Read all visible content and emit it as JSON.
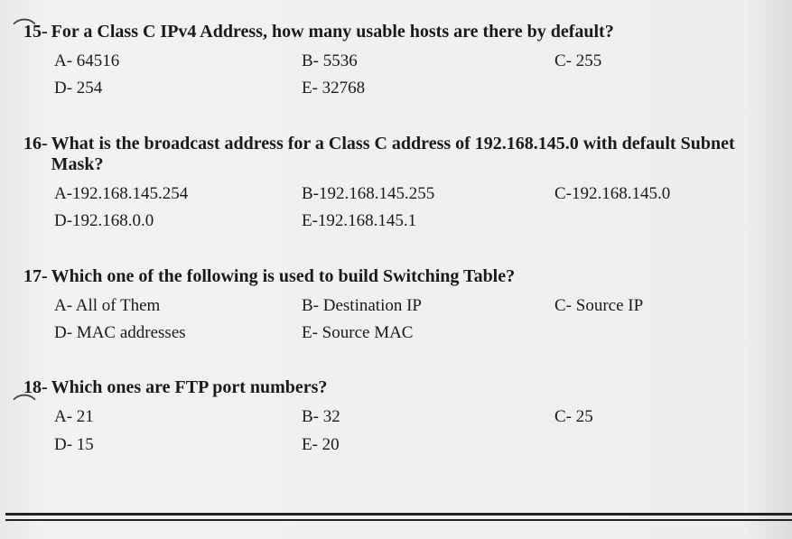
{
  "questions": [
    {
      "number": "15-",
      "text": "For a Class C IPv4 Address, how many usable hosts are there by default?",
      "rows": [
        {
          "a": "A-  64516",
          "b": "B- 5536",
          "c": "C- 255"
        },
        {
          "a": "D- 254",
          "b": "E- 32768",
          "c": ""
        }
      ]
    },
    {
      "number": "16-",
      "text": "What is the broadcast address for a Class C address of 192.168.145.0 with default Subnet Mask?",
      "rows": [
        {
          "a": "A-192.168.145.254",
          "b": "B-192.168.145.255",
          "c": "C-192.168.145.0"
        },
        {
          "a": "D-192.168.0.0",
          "b": "E-192.168.145.1",
          "c": ""
        }
      ]
    },
    {
      "number": "17-",
      "text": "Which one of the following is used to build Switching Table?",
      "rows": [
        {
          "a": "A-  All of Them",
          "b": "B- Destination IP",
          "c": "C- Source IP"
        },
        {
          "a": "D-  MAC addresses",
          "b": "E- Source MAC",
          "c": ""
        }
      ]
    },
    {
      "number": "18-",
      "text": "Which ones are FTP port numbers?",
      "rows": [
        {
          "a": "A- 21",
          "b": "B- 32",
          "c": "C- 25"
        },
        {
          "a": "D- 15",
          "b": "E- 20",
          "c": ""
        }
      ]
    }
  ]
}
